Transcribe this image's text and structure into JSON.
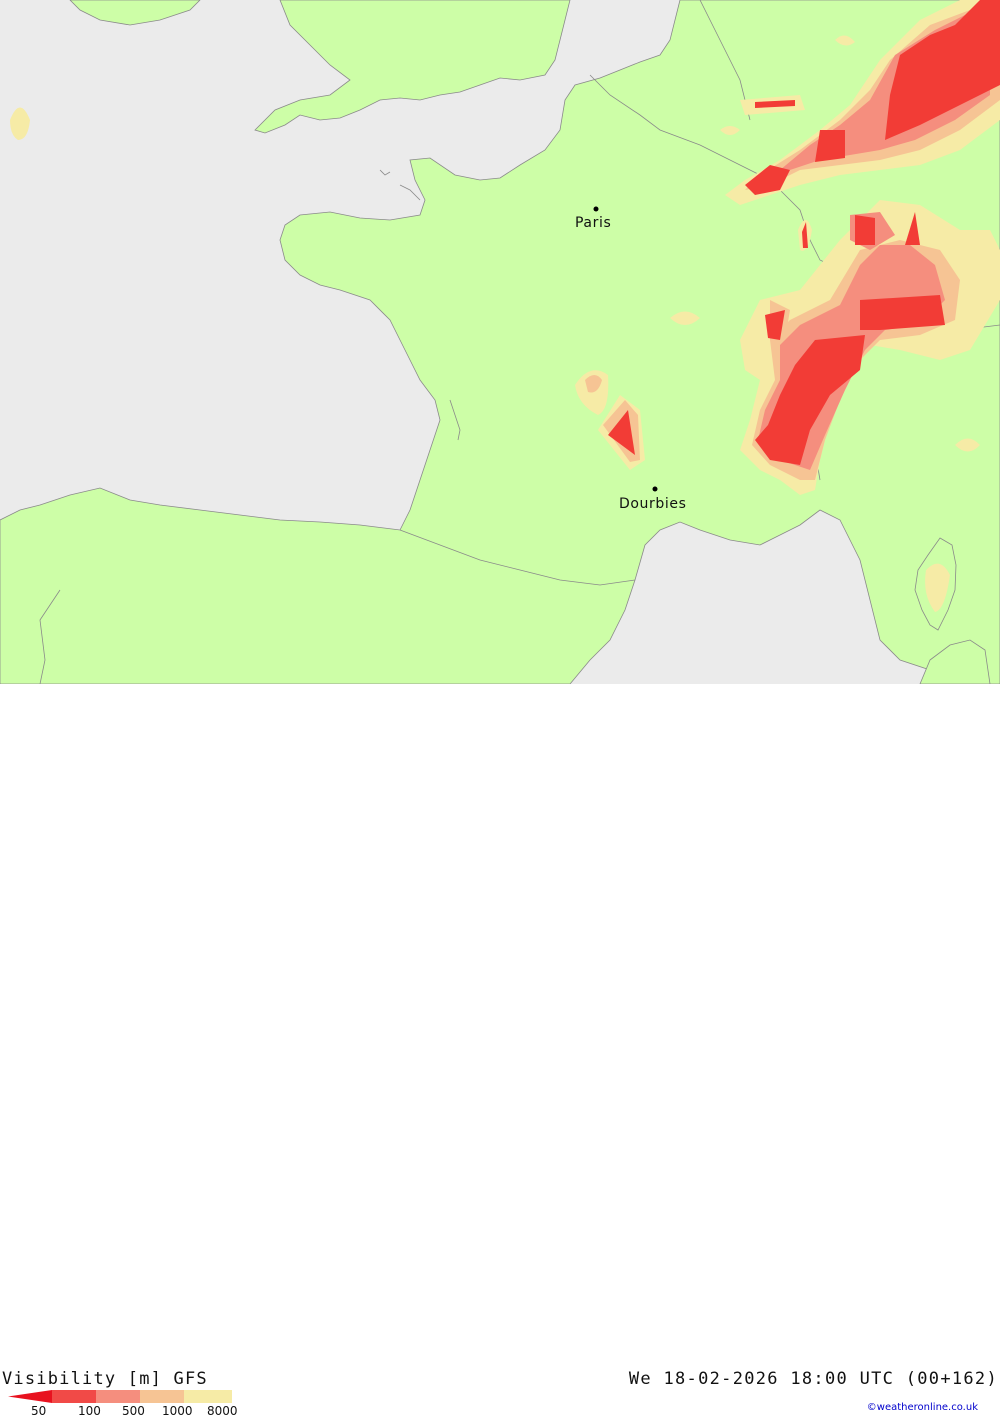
{
  "header": {
    "title": "Visibility [m] GFS",
    "datetime": "We 18-02-2026 18:00 UTC (00+162)",
    "credit": "©weatheronline.co.uk"
  },
  "legend": {
    "items": [
      {
        "label": "50",
        "color": "#e8121f"
      },
      {
        "label": "100",
        "color": "#f14a47"
      },
      {
        "label": "500",
        "color": "#f58e7e"
      },
      {
        "label": "1000",
        "color": "#f6c494"
      },
      {
        "label": "8000",
        "color": "#f6eba6"
      }
    ]
  },
  "map": {
    "sea_color": "#ebebeb",
    "land_color": "#cdfea7",
    "cities": [
      {
        "name": "Paris"
      },
      {
        "name": "Dourbies"
      }
    ]
  }
}
